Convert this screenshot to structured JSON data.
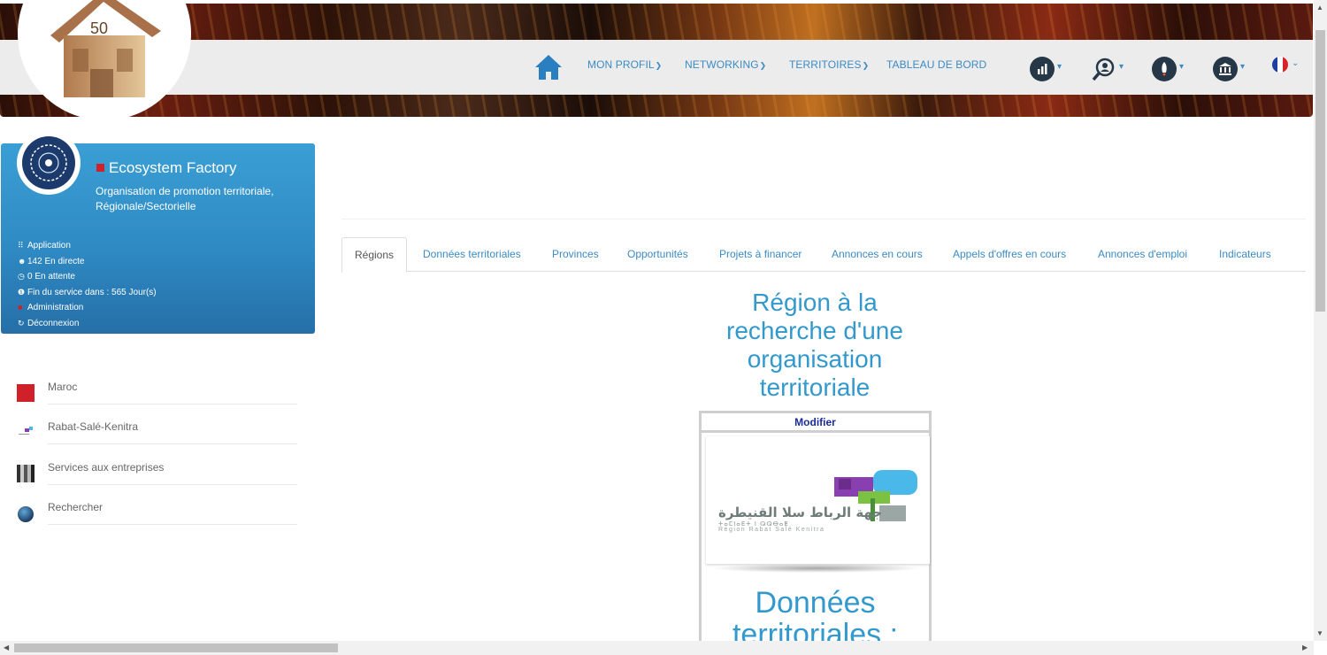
{
  "nav": {
    "links": [
      {
        "label": "MON PROFIL",
        "has_dropdown": true
      },
      {
        "label": "NETWORKING",
        "has_dropdown": true
      },
      {
        "label": "TERRITOIRES",
        "has_dropdown": true
      },
      {
        "label": "TABLEAU DE BORD",
        "has_dropdown": false
      }
    ],
    "icons": [
      "bar-chart-icon",
      "search-user-icon",
      "rocket-icon",
      "bank-icon"
    ],
    "language_flag": "france-flag-icon"
  },
  "profile": {
    "title": "Ecosystem Factory",
    "subtitle": "Organisation de promotion territoriale, Régionale/Sectorielle",
    "items": [
      {
        "icon": "grid-icon",
        "glyph": "⠿",
        "label": "Application"
      },
      {
        "icon": "users-icon",
        "glyph": "👤",
        "label": "142 En directe"
      },
      {
        "icon": "clock-icon",
        "glyph": "◷",
        "label": "0 En attente"
      },
      {
        "icon": "info-icon",
        "glyph": "ℹ",
        "label": "Fin du service dans : 565 Jour(s)"
      },
      {
        "icon": "admin-icon",
        "glyph": "■",
        "label": "Administration"
      },
      {
        "icon": "logout-icon",
        "glyph": "↻",
        "label": "Déconnexion"
      }
    ]
  },
  "menu": [
    {
      "label": "Maroc"
    },
    {
      "label": "Rabat-Salé-Kenitra"
    },
    {
      "label": "Services aux entreprises"
    },
    {
      "label": "Rechercher"
    }
  ],
  "tabs": [
    {
      "label": "Régions",
      "active": true
    },
    {
      "label": "Données territoriales"
    },
    {
      "label": "Provinces"
    },
    {
      "label": "Opportunités"
    },
    {
      "label": "Projets à financer"
    },
    {
      "label": "Annonces en cours"
    },
    {
      "label": "Appels d'offres en cours"
    },
    {
      "label": "Annonces d'emploi"
    },
    {
      "label": "Indicateurs"
    }
  ],
  "content": {
    "region_title": "Région à la recherche d'une organisation territoriale",
    "modifier_label": "Modifier",
    "logo_arabic": "جهة الرباط سلا القنيطرة",
    "logo_tifinagh": "ⵜⴰⵎⵏⴰⴹⵜ ⵏ ⵕⵕⴱⴰⵟ",
    "logo_latin": "Région Rabat Salé Kenitra",
    "donnees_title": "Données territoriales :"
  },
  "colors": {
    "accent": "#3b8bc4",
    "card": "#2f8ac3",
    "red": "#d0212a"
  }
}
